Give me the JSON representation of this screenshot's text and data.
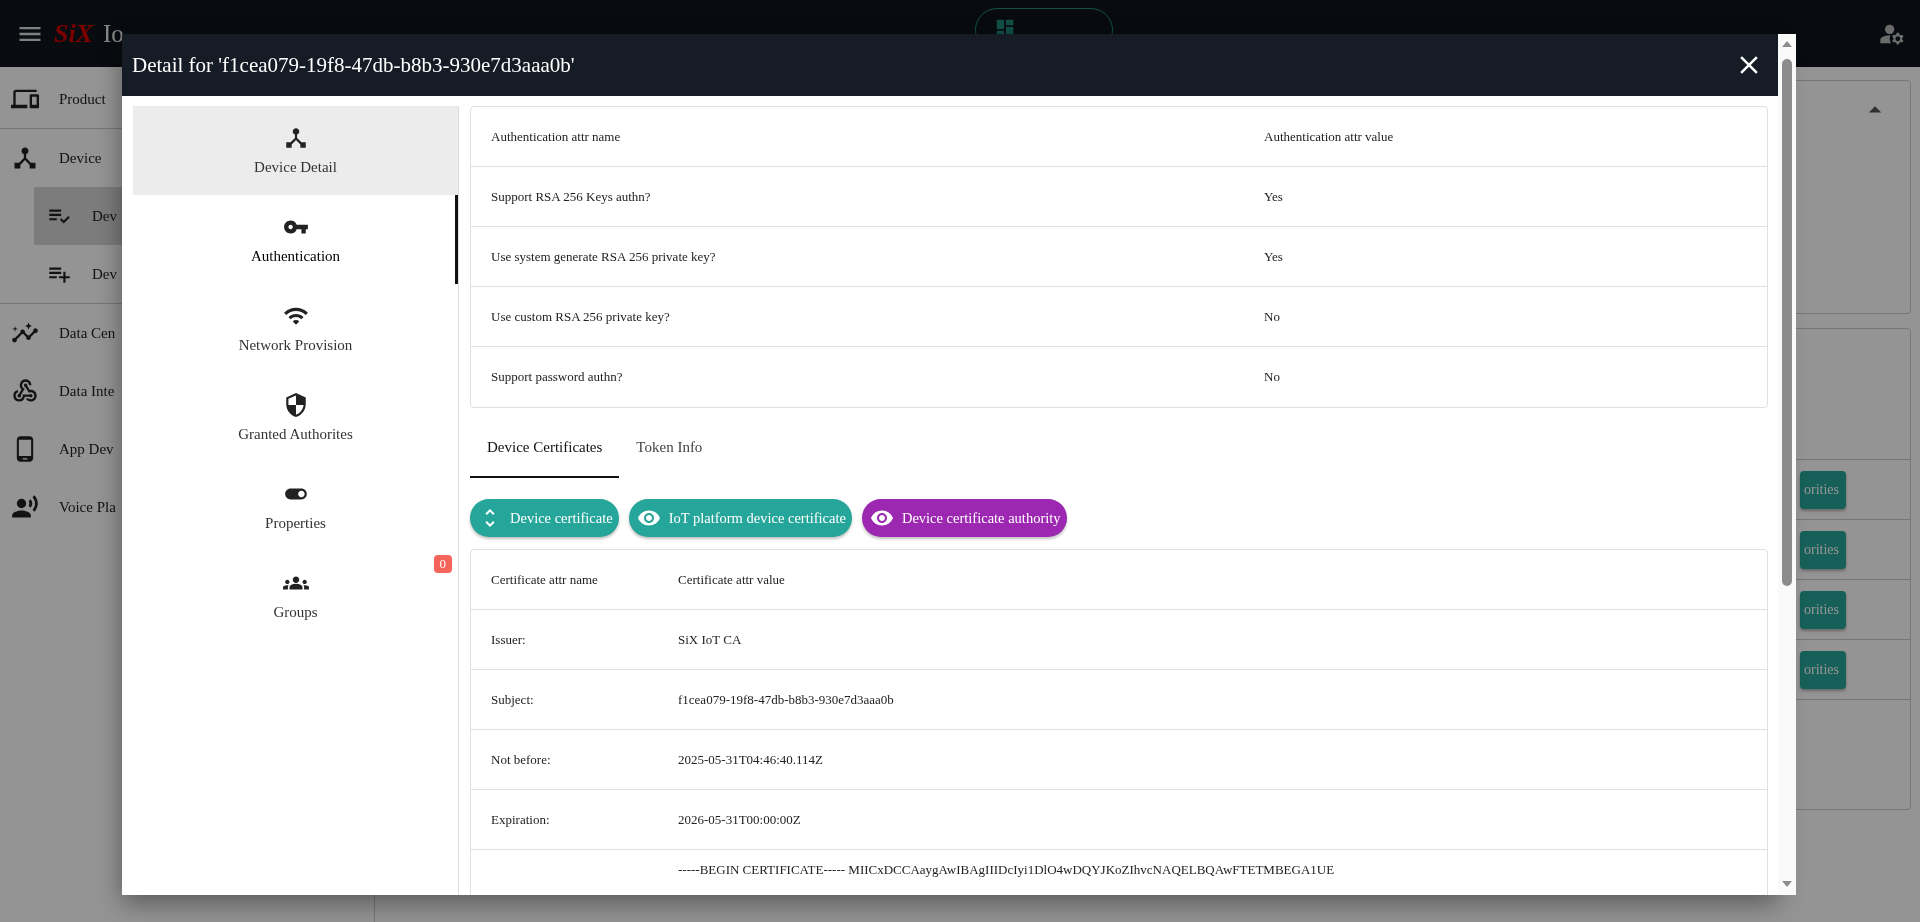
{
  "app_bar": {
    "logo": "SiX",
    "title": "Io"
  },
  "sidebar": {
    "items": [
      {
        "label": "Product",
        "selected": false
      },
      {
        "label": "Device",
        "selected": false,
        "children": [
          {
            "label": "Dev",
            "selected": true
          },
          {
            "label": "Dev",
            "selected": false
          }
        ]
      },
      {
        "label": "Data Cen",
        "selected": false
      },
      {
        "label": "Data Inte",
        "selected": false
      },
      {
        "label": "App Dev",
        "selected": false
      },
      {
        "label": "Voice Pla",
        "selected": false
      }
    ]
  },
  "background": {
    "action_buttons": [
      "orities",
      "orities",
      "orities",
      "orities"
    ]
  },
  "dialog": {
    "title": "Detail for 'f1cea079-19f8-47db-b8b3-930e7d3aaa0b'",
    "nav": [
      {
        "label": "Device Detail",
        "selected": false,
        "highlighted": true
      },
      {
        "label": "Authentication",
        "selected": true,
        "highlighted": false
      },
      {
        "label": "Network Provision",
        "selected": false,
        "highlighted": false
      },
      {
        "label": "Granted Authorites",
        "selected": false,
        "highlighted": false
      },
      {
        "label": "Properties",
        "selected": false,
        "highlighted": false
      },
      {
        "label": "Groups",
        "selected": false,
        "highlighted": false,
        "badge": "0"
      }
    ],
    "auth_table": {
      "columns": [
        "Authentication attr name",
        "Authentication attr value"
      ],
      "rows": [
        [
          "Support RSA 256 Keys authn?",
          "Yes"
        ],
        [
          "Use system generate RSA 256 private key?",
          "Yes"
        ],
        [
          "Use custom RSA 256 private key?",
          "No"
        ],
        [
          "Support password authn?",
          "No"
        ]
      ]
    },
    "tabs": [
      {
        "label": "Device Certificates",
        "selected": true
      },
      {
        "label": "Token Info",
        "selected": false
      }
    ],
    "chips": [
      {
        "label": "Device certificate",
        "color": "#26a69a"
      },
      {
        "label": "IoT platform device certificate",
        "color": "#26a69a"
      },
      {
        "label": "Device certificate authority",
        "color": "#9c27b0"
      }
    ],
    "cert_table": {
      "columns": [
        "Certificate attr name",
        "Certificate attr value"
      ],
      "rows": [
        [
          "Issuer:",
          "SiX IoT CA"
        ],
        [
          "Subject:",
          "f1cea079-19f8-47db-b8b3-930e7d3aaa0b"
        ],
        [
          "Not before:",
          "2025-05-31T04:46:40.114Z"
        ],
        [
          "Expiration:",
          "2026-05-31T00:00:00Z"
        ],
        [
          "",
          "-----BEGIN CERTIFICATE----- MIICxDCCAaygAwIBAgIIIDcIyi1DlO4wDQYJKoZIhvcNAQELBQAwFTETMBEGA1UE"
        ]
      ]
    }
  }
}
